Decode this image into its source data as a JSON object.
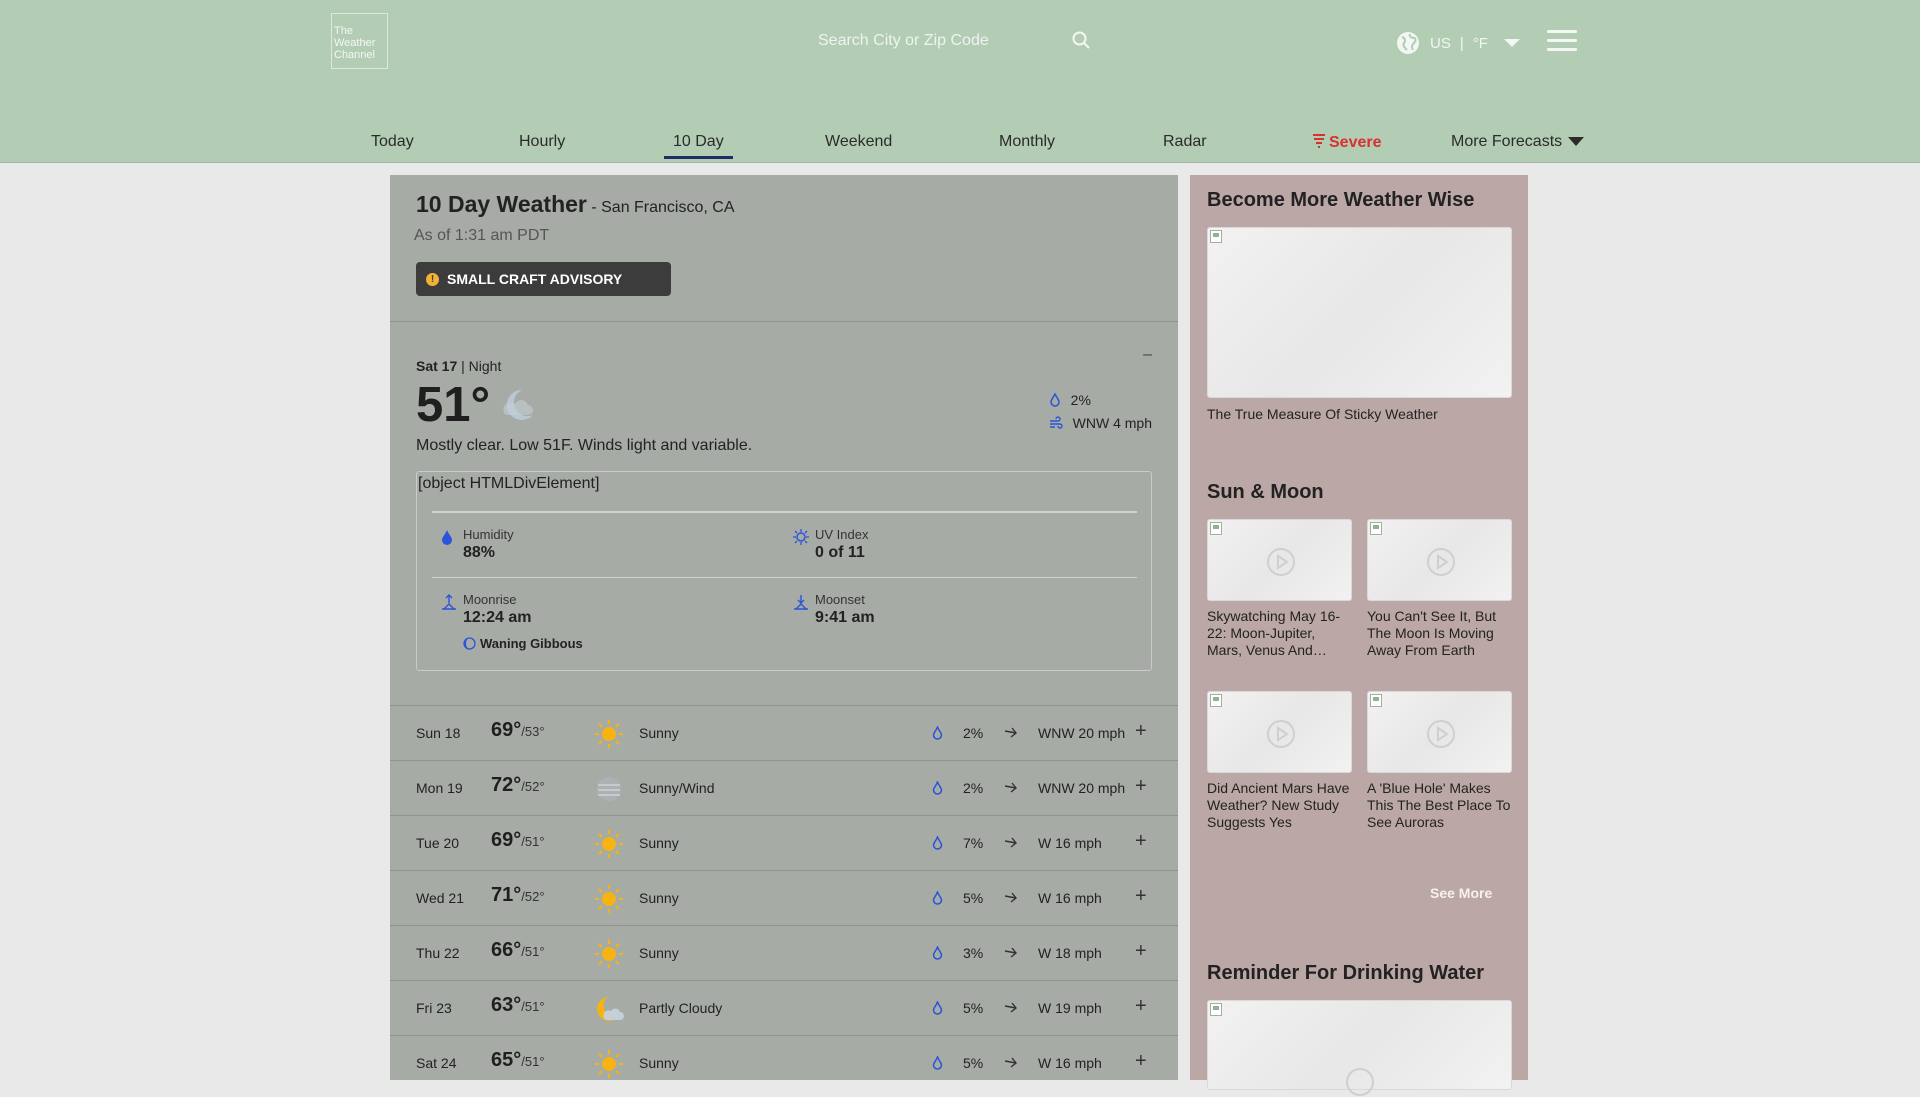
{
  "header": {
    "logo_text": "The Weather Channel",
    "search_placeholder": "Search City or Zip Code",
    "locale_country": "US",
    "locale_separator": "|",
    "locale_unit": "°F"
  },
  "nav": {
    "items": [
      {
        "label": "Today"
      },
      {
        "label": "Hourly"
      },
      {
        "label": "10 Day",
        "active": true
      },
      {
        "label": "Weekend"
      },
      {
        "label": "Monthly"
      },
      {
        "label": "Radar"
      },
      {
        "label": "Severe"
      },
      {
        "label": "More Forecasts"
      }
    ]
  },
  "main": {
    "title": "10 Day Weather",
    "location": "- San Francisco, CA",
    "as_of": "As of 1:31 am PDT",
    "advisory": "SMALL CRAFT ADVISORY",
    "detail": {
      "collapse": "–",
      "day": "Sat 17",
      "separator": "|",
      "period": "Night",
      "temp": "51°",
      "precip": "2%",
      "wind": "WNW 4 mph",
      "narrative": "Mostly clear. Low 51F. Winds light and variable.",
      "object_text": "[object HTMLDivElement]",
      "humidity_label": "Humidity",
      "humidity_value": "88%",
      "uv_label": "UV Index",
      "uv_value": "0 of 11",
      "moonrise_label": "Moonrise",
      "moonrise_value": "12:24 am",
      "moonset_label": "Moonset",
      "moonset_value": "9:41 am",
      "moon_phase": "Waning Gibbous"
    },
    "days": [
      {
        "day": "Sun 18",
        "hi": "69°",
        "lo": "/53°",
        "icon": "sunny-icon",
        "cond": "Sunny",
        "precip": "2%",
        "wind": "WNW 20 mph"
      },
      {
        "day": "Mon 19",
        "hi": "72°",
        "lo": "/52°",
        "icon": "sunny-wind-icon",
        "cond": "Sunny/Wind",
        "precip": "2%",
        "wind": "WNW 20 mph"
      },
      {
        "day": "Tue 20",
        "hi": "69°",
        "lo": "/51°",
        "icon": "sunny-icon",
        "cond": "Sunny",
        "precip": "7%",
        "wind": "W 16 mph"
      },
      {
        "day": "Wed 21",
        "hi": "71°",
        "lo": "/52°",
        "icon": "sunny-icon",
        "cond": "Sunny",
        "precip": "5%",
        "wind": "W 16 mph"
      },
      {
        "day": "Thu 22",
        "hi": "66°",
        "lo": "/51°",
        "icon": "sunny-icon",
        "cond": "Sunny",
        "precip": "3%",
        "wind": "W 18 mph"
      },
      {
        "day": "Fri 23",
        "hi": "63°",
        "lo": "/51°",
        "icon": "partly-cloudy-icon",
        "cond": "Partly Cloudy",
        "precip": "5%",
        "wind": "W 19 mph"
      },
      {
        "day": "Sat 24",
        "hi": "65°",
        "lo": "/51°",
        "icon": "sunny-icon",
        "cond": "Sunny",
        "precip": "5%",
        "wind": "W 16 mph"
      }
    ],
    "expand_symbol": "+"
  },
  "sidebar": {
    "weather_wise_title": "Become More Weather Wise",
    "weather_wise_caption": "The True Measure Of Sticky Weather",
    "sun_moon_title": "Sun & Moon",
    "sun_moon_cards": [
      {
        "caption": "Skywatching May 16-22: Moon-Jupiter, Mars, Venus And…"
      },
      {
        "caption": "You Can't See It, But The Moon Is Moving Away From Earth"
      },
      {
        "caption": "Did Ancient Mars Have Weather? New Study Suggests Yes"
      },
      {
        "caption": "A 'Blue Hole' Makes This The Best Place To See Auroras"
      }
    ],
    "see_more": "See More",
    "reminder_title": "Reminder For Drinking Water"
  },
  "colors": {
    "header_bg": "#b3ccb4",
    "main_bg": "#a6aba6",
    "sidebar_bg": "#bba8a6",
    "severe": "#d6322f",
    "active_tab_underline": "#1e2f64",
    "advisory_bg": "#3c3c3c",
    "sun": "#f6b312"
  }
}
